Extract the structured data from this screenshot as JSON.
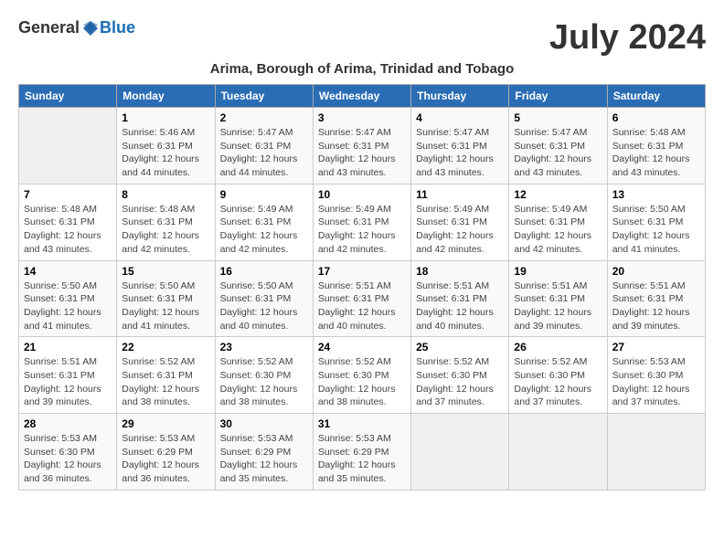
{
  "header": {
    "logo_general": "General",
    "logo_blue": "Blue",
    "month_year": "July 2024",
    "location": "Arima, Borough of Arima, Trinidad and Tobago"
  },
  "weekdays": [
    "Sunday",
    "Monday",
    "Tuesday",
    "Wednesday",
    "Thursday",
    "Friday",
    "Saturday"
  ],
  "weeks": [
    [
      {
        "day": "",
        "info": ""
      },
      {
        "day": "1",
        "info": "Sunrise: 5:46 AM\nSunset: 6:31 PM\nDaylight: 12 hours\nand 44 minutes."
      },
      {
        "day": "2",
        "info": "Sunrise: 5:47 AM\nSunset: 6:31 PM\nDaylight: 12 hours\nand 44 minutes."
      },
      {
        "day": "3",
        "info": "Sunrise: 5:47 AM\nSunset: 6:31 PM\nDaylight: 12 hours\nand 43 minutes."
      },
      {
        "day": "4",
        "info": "Sunrise: 5:47 AM\nSunset: 6:31 PM\nDaylight: 12 hours\nand 43 minutes."
      },
      {
        "day": "5",
        "info": "Sunrise: 5:47 AM\nSunset: 6:31 PM\nDaylight: 12 hours\nand 43 minutes."
      },
      {
        "day": "6",
        "info": "Sunrise: 5:48 AM\nSunset: 6:31 PM\nDaylight: 12 hours\nand 43 minutes."
      }
    ],
    [
      {
        "day": "7",
        "info": "Sunrise: 5:48 AM\nSunset: 6:31 PM\nDaylight: 12 hours\nand 43 minutes."
      },
      {
        "day": "8",
        "info": "Sunrise: 5:48 AM\nSunset: 6:31 PM\nDaylight: 12 hours\nand 42 minutes."
      },
      {
        "day": "9",
        "info": "Sunrise: 5:49 AM\nSunset: 6:31 PM\nDaylight: 12 hours\nand 42 minutes."
      },
      {
        "day": "10",
        "info": "Sunrise: 5:49 AM\nSunset: 6:31 PM\nDaylight: 12 hours\nand 42 minutes."
      },
      {
        "day": "11",
        "info": "Sunrise: 5:49 AM\nSunset: 6:31 PM\nDaylight: 12 hours\nand 42 minutes."
      },
      {
        "day": "12",
        "info": "Sunrise: 5:49 AM\nSunset: 6:31 PM\nDaylight: 12 hours\nand 42 minutes."
      },
      {
        "day": "13",
        "info": "Sunrise: 5:50 AM\nSunset: 6:31 PM\nDaylight: 12 hours\nand 41 minutes."
      }
    ],
    [
      {
        "day": "14",
        "info": "Sunrise: 5:50 AM\nSunset: 6:31 PM\nDaylight: 12 hours\nand 41 minutes."
      },
      {
        "day": "15",
        "info": "Sunrise: 5:50 AM\nSunset: 6:31 PM\nDaylight: 12 hours\nand 41 minutes."
      },
      {
        "day": "16",
        "info": "Sunrise: 5:50 AM\nSunset: 6:31 PM\nDaylight: 12 hours\nand 40 minutes."
      },
      {
        "day": "17",
        "info": "Sunrise: 5:51 AM\nSunset: 6:31 PM\nDaylight: 12 hours\nand 40 minutes."
      },
      {
        "day": "18",
        "info": "Sunrise: 5:51 AM\nSunset: 6:31 PM\nDaylight: 12 hours\nand 40 minutes."
      },
      {
        "day": "19",
        "info": "Sunrise: 5:51 AM\nSunset: 6:31 PM\nDaylight: 12 hours\nand 39 minutes."
      },
      {
        "day": "20",
        "info": "Sunrise: 5:51 AM\nSunset: 6:31 PM\nDaylight: 12 hours\nand 39 minutes."
      }
    ],
    [
      {
        "day": "21",
        "info": "Sunrise: 5:51 AM\nSunset: 6:31 PM\nDaylight: 12 hours\nand 39 minutes."
      },
      {
        "day": "22",
        "info": "Sunrise: 5:52 AM\nSunset: 6:31 PM\nDaylight: 12 hours\nand 38 minutes."
      },
      {
        "day": "23",
        "info": "Sunrise: 5:52 AM\nSunset: 6:30 PM\nDaylight: 12 hours\nand 38 minutes."
      },
      {
        "day": "24",
        "info": "Sunrise: 5:52 AM\nSunset: 6:30 PM\nDaylight: 12 hours\nand 38 minutes."
      },
      {
        "day": "25",
        "info": "Sunrise: 5:52 AM\nSunset: 6:30 PM\nDaylight: 12 hours\nand 37 minutes."
      },
      {
        "day": "26",
        "info": "Sunrise: 5:52 AM\nSunset: 6:30 PM\nDaylight: 12 hours\nand 37 minutes."
      },
      {
        "day": "27",
        "info": "Sunrise: 5:53 AM\nSunset: 6:30 PM\nDaylight: 12 hours\nand 37 minutes."
      }
    ],
    [
      {
        "day": "28",
        "info": "Sunrise: 5:53 AM\nSunset: 6:30 PM\nDaylight: 12 hours\nand 36 minutes."
      },
      {
        "day": "29",
        "info": "Sunrise: 5:53 AM\nSunset: 6:29 PM\nDaylight: 12 hours\nand 36 minutes."
      },
      {
        "day": "30",
        "info": "Sunrise: 5:53 AM\nSunset: 6:29 PM\nDaylight: 12 hours\nand 35 minutes."
      },
      {
        "day": "31",
        "info": "Sunrise: 5:53 AM\nSunset: 6:29 PM\nDaylight: 12 hours\nand 35 minutes."
      },
      {
        "day": "",
        "info": ""
      },
      {
        "day": "",
        "info": ""
      },
      {
        "day": "",
        "info": ""
      }
    ]
  ]
}
